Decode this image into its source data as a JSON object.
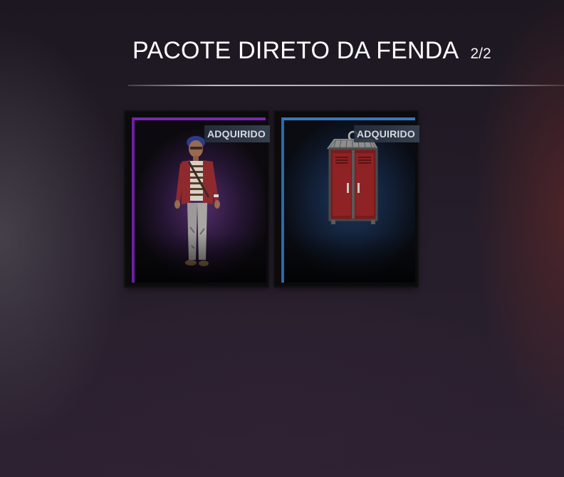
{
  "header": {
    "title": "PACOTE DIRETO DA FENDA",
    "counter": "2/2"
  },
  "items": [
    {
      "badge": "ADQUIRIDO",
      "rarity_color": "#6a1fa0",
      "item_icon": "survivor-outfit-icon"
    },
    {
      "badge": "ADQUIRIDO",
      "rarity_color": "#2e68a8",
      "item_icon": "locker-icon"
    }
  ]
}
